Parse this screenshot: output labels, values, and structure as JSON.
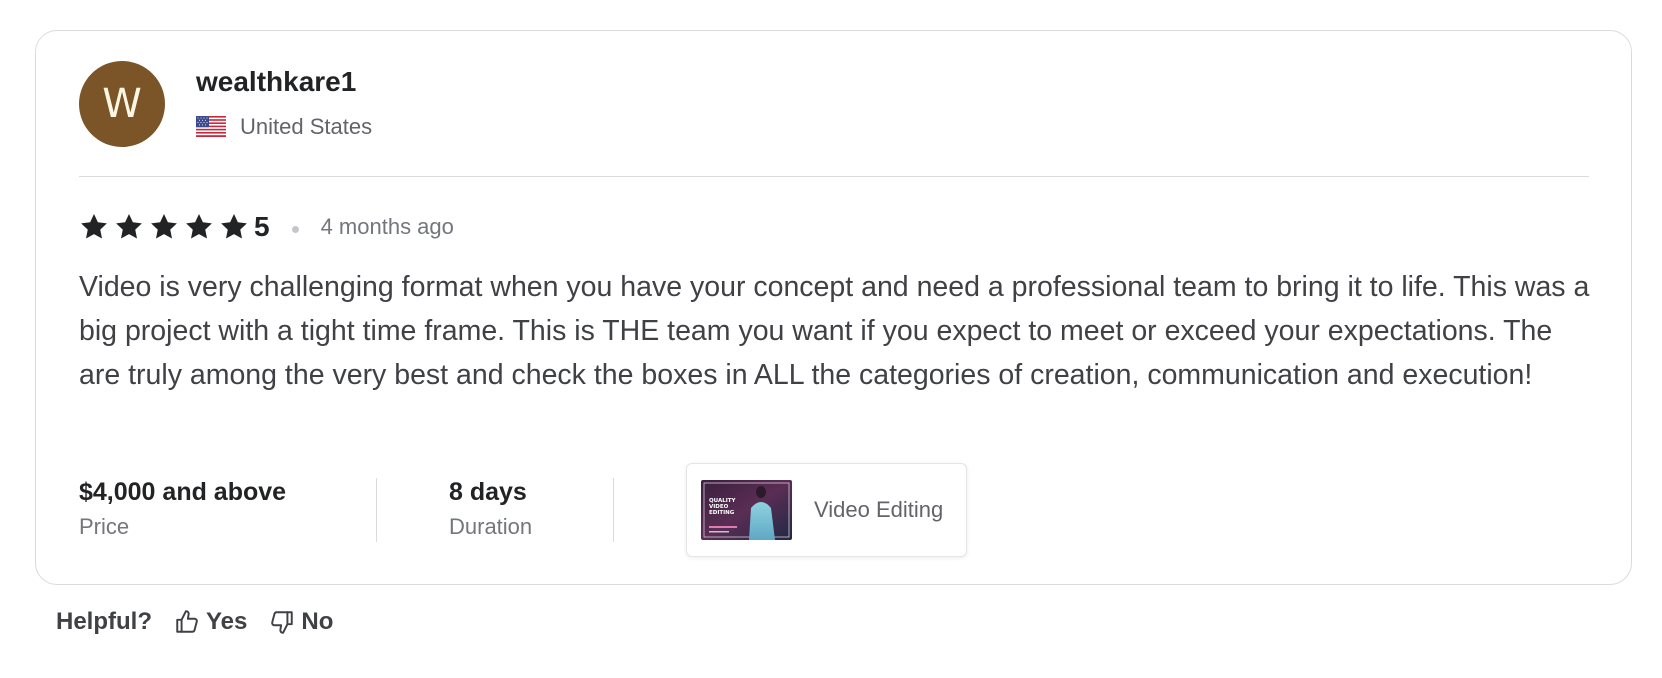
{
  "reviewer": {
    "avatar_initial": "W",
    "avatar_color": "#7b5427",
    "username": "wealthkare1",
    "country": "United States",
    "flag_icon": "us-flag-icon"
  },
  "rating": {
    "stars": 5,
    "value": "5",
    "time_ago": "4 months ago"
  },
  "review": {
    "text": "Video is very challenging format when you have your concept and need a professional team to bring it to life. This was a big project with a tight time frame. This is THE team you want if you expect to meet or exceed your expectations. The are truly among the very best and check the boxes in ALL the categories of creation, communication and execution!"
  },
  "meta": {
    "price_value": "$4,000 and above",
    "price_label": "Price",
    "duration_value": "8 days",
    "duration_label": "Duration"
  },
  "gig": {
    "title": "Video Editing",
    "thumbnail_text": [
      "QUALITY",
      "VIDEO",
      "EDITING"
    ]
  },
  "helpful": {
    "label": "Helpful?",
    "yes_label": "Yes",
    "no_label": "No",
    "yes_icon": "thumbs-up-icon",
    "no_icon": "thumbs-down-icon"
  }
}
